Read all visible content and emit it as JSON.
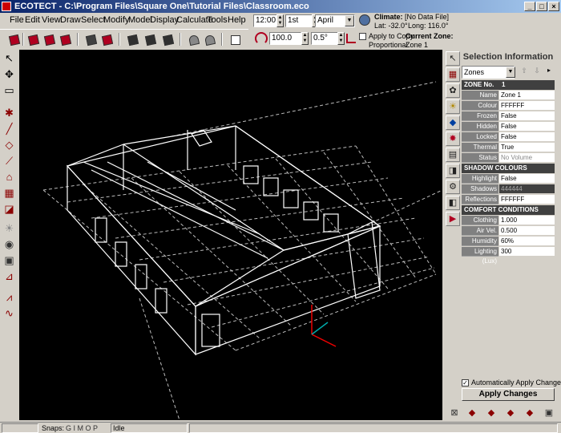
{
  "window": {
    "title": "ECOTECT - C:\\Program Files\\Square One\\Tutorial Files\\Classroom.eco"
  },
  "menu": [
    "File",
    "Edit",
    "View",
    "Draw",
    "Select",
    "Modify",
    "Model",
    "Display",
    "Calculate",
    "Tools",
    "Help"
  ],
  "time": {
    "value": "12:00",
    "day": "1st",
    "month": "April"
  },
  "climate": {
    "label": "Climate:",
    "file": "[No Data File]",
    "lat": "Lat: -32.0°",
    "long": "Long: 116.0°"
  },
  "snap": {
    "grid": "100.0",
    "angle": "0.5°"
  },
  "apply_copy": {
    "line1": "Apply to Copy",
    "line2": "Proportional"
  },
  "zone": {
    "label": "Current Zone:",
    "value": "Zone 1"
  },
  "panel": {
    "title": "Selection Information",
    "selector": "Zones",
    "zone_header": {
      "label": "ZONE No.",
      "value": "1"
    },
    "rows": [
      {
        "k": "Name",
        "v": "Zone 1"
      },
      {
        "k": "Colour",
        "v": "FFFFFF"
      },
      {
        "k": "Frozen",
        "v": "False"
      },
      {
        "k": "Hidden",
        "v": "False"
      },
      {
        "k": "Locked",
        "v": "False"
      },
      {
        "k": "Thermal",
        "v": "True"
      },
      {
        "k": "Status",
        "v": "No Volume"
      }
    ],
    "shadow_header": "SHADOW COLOURS",
    "shadow_rows": [
      {
        "k": "Highlight",
        "v": "False"
      },
      {
        "k": "Shadows",
        "v": "444444"
      },
      {
        "k": "Reflections",
        "v": "FFFFFF"
      }
    ],
    "comfort_header": "COMFORT CONDITIONS",
    "comfort_rows": [
      {
        "k": "Clothing (clo)",
        "v": "1.000"
      },
      {
        "k": "Air Vel. (m/s)",
        "v": "0.500"
      },
      {
        "k": "Humidity (%)",
        "v": "60%"
      },
      {
        "k": "Lighting (Lux)",
        "v": "300"
      }
    ],
    "auto_apply": "Automatically Apply Changes",
    "apply_button": "Apply Changes"
  },
  "status": {
    "snaps_label": "Snaps:",
    "snaps": "G I M O P",
    "state": "Idle"
  }
}
